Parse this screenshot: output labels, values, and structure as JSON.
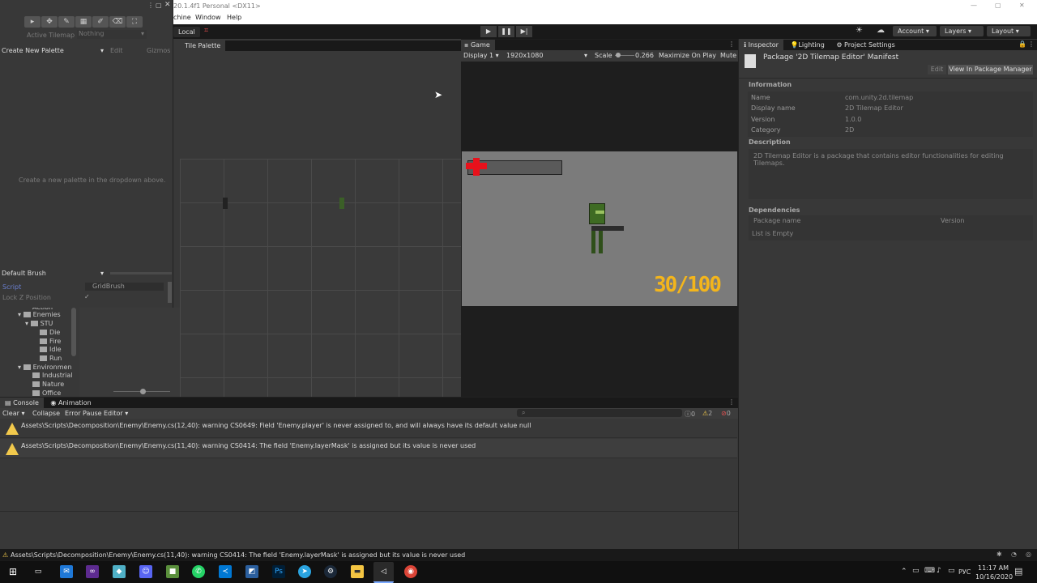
{
  "window": {
    "title": "20.1.4f1 Personal <DX11>",
    "controls": [
      "—",
      "▢",
      "✕"
    ]
  },
  "menu": {
    "items": [
      "chine",
      "Window",
      "Help"
    ]
  },
  "toolbar": {
    "local_label": "Local",
    "account_label": "Account",
    "layers_label": "Layers",
    "layout_label": "Layout"
  },
  "tile_overlay": {
    "active_tilemap_label": "Active Tilemap",
    "active_tilemap_value": "Nothing",
    "palette_dropdown": "Create New Palette",
    "edit_label": "Edit",
    "gizmos_label": "Gizmos",
    "hint": "Create a new palette in the dropdown above.",
    "brush_dropdown": "Default Brush",
    "script_label": "Script",
    "script_value": "GridBrush",
    "lock_z_label": "Lock Z Position",
    "lock_z_check": "✓"
  },
  "tile_palette": {
    "tab_label": "Tile Palette"
  },
  "project_tree": {
    "items": [
      {
        "label": "Action",
        "level": 3
      },
      {
        "label": "Enemies",
        "level": 1
      },
      {
        "label": "STU",
        "level": 2
      },
      {
        "label": "Die",
        "level": 3
      },
      {
        "label": "Fire",
        "level": 3
      },
      {
        "label": "Idle",
        "level": 3
      },
      {
        "label": "Run",
        "level": 3
      },
      {
        "label": "Environmen",
        "level": 1
      },
      {
        "label": "Industrial",
        "level": 2
      },
      {
        "label": "Nature",
        "level": 2
      },
      {
        "label": "Office",
        "level": 2
      }
    ]
  },
  "game": {
    "tab_label": "Game",
    "display": "Display 1",
    "resolution": "1920x1080",
    "scale_label": "Scale",
    "scale_value": "0.266",
    "maximize": "Maximize On Play",
    "mute": "Mute",
    "ammo": "30/100",
    "colors": {
      "sky": "#7b7b7b",
      "ammo": "#f3b51c",
      "health": "#e8111b"
    }
  },
  "inspector": {
    "tabs": [
      "Inspector",
      "Lighting",
      "Project Settings"
    ],
    "header": "Package '2D Tilemap Editor' Manifest",
    "edit_label": "Edit",
    "view_pm_label": "View In Package Manager",
    "information_heading": "Information",
    "fields": [
      {
        "label": "Name",
        "value": "com.unity.2d.tilemap"
      },
      {
        "label": "Display name",
        "value": "2D Tilemap Editor"
      },
      {
        "label": "Version",
        "value": "1.0.0"
      },
      {
        "label": "Category",
        "value": "2D"
      }
    ],
    "description_heading": "Description",
    "description": "2D Tilemap Editor is a package that contains editor functionalities for editing Tilemaps.",
    "dependencies_heading": "Dependencies",
    "dep_col_name": "Package name",
    "dep_col_version": "Version",
    "dep_empty": "List is Empty"
  },
  "console": {
    "tabs": [
      "Console",
      "Animation"
    ],
    "buttons": {
      "clear": "Clear",
      "collapse": "Collapse",
      "error_pause": "Error Pause",
      "editor": "Editor"
    },
    "counts": {
      "info": "0",
      "warn": "2",
      "error": "0"
    },
    "messages": [
      "Assets\\Scripts\\Decomposition\\Enemy\\Enemy.cs(12,40): warning CS0649: Field 'Enemy.player' is never assigned to, and will always have its default value null",
      "Assets\\Scripts\\Decomposition\\Enemy\\Enemy.cs(11,40): warning CS0414: The field 'Enemy.layerMask' is assigned but its value is never used"
    ],
    "status": "Assets\\Scripts\\Decomposition\\Enemy\\Enemy.cs(11,40): warning CS0414: The field 'Enemy.layerMask' is assigned but its value is never used"
  },
  "taskbar": {
    "lang": "РУС",
    "time": "11:17 AM",
    "date": "10/16/2020",
    "apps": [
      "windows-start",
      "task-view",
      "mail",
      "visual-studio",
      "app4",
      "discord",
      "minecraft",
      "whatsapp",
      "vscode",
      "app9",
      "photoshop",
      "telegram",
      "steam",
      "explorer",
      "unity",
      "chrome"
    ]
  }
}
